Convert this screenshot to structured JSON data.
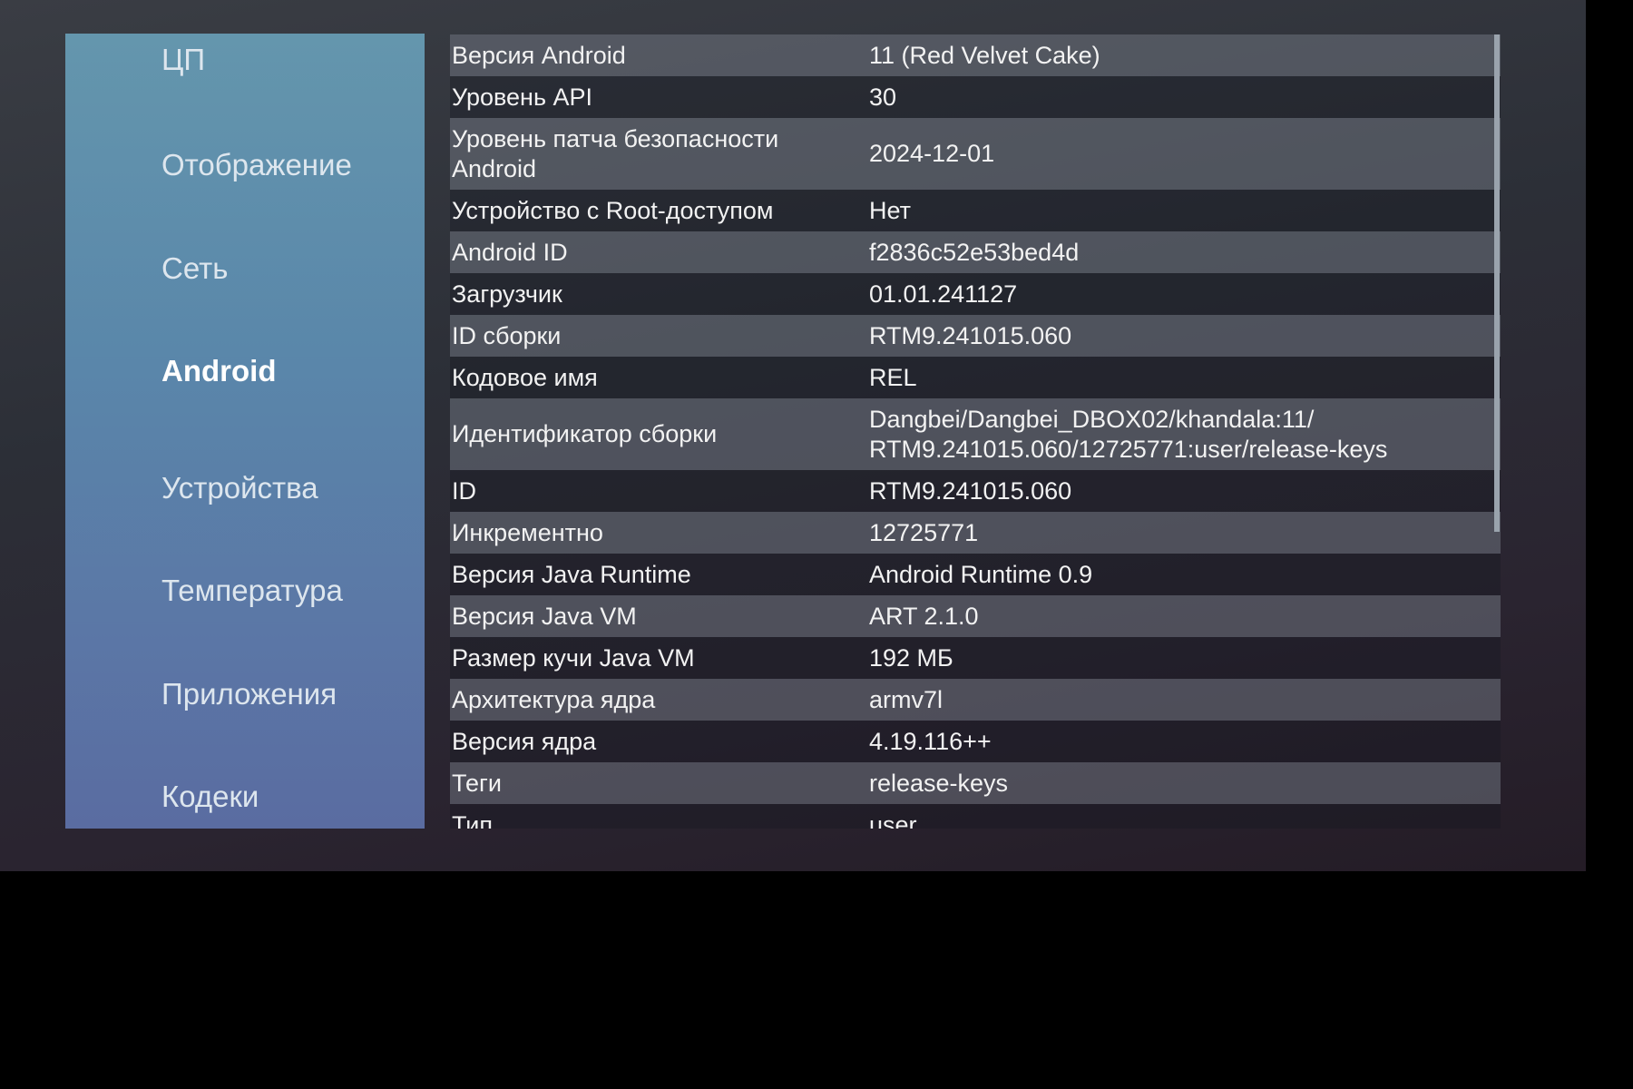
{
  "sidebar": {
    "items": [
      {
        "label": "ЦП"
      },
      {
        "label": "Отображение"
      },
      {
        "label": "Сеть"
      },
      {
        "label": "Android",
        "active": true
      },
      {
        "label": "Устройства"
      },
      {
        "label": "Температура"
      },
      {
        "label": "Приложения"
      },
      {
        "label": "Кодеки"
      }
    ]
  },
  "table": {
    "rows": [
      {
        "key": "Версия Android",
        "value": "11 (Red Velvet Cake)"
      },
      {
        "key": "Уровень API",
        "value": "30"
      },
      {
        "key": "Уровень патча безопасности Android",
        "value": "2024-12-01"
      },
      {
        "key": "Устройство с Root-доступом",
        "value": "Нет"
      },
      {
        "key": "Android ID",
        "value": "f2836c52e53bed4d"
      },
      {
        "key": "Загрузчик",
        "value": "01.01.241127"
      },
      {
        "key": "ID сборки",
        "value": "RTM9.241015.060"
      },
      {
        "key": "Кодовое имя",
        "value": "REL"
      },
      {
        "key": "Идентификатор сборки",
        "value": "Dangbei/Dangbei_DBOX02/khandala:11/ RTM9.241015.060/12725771:user/release-keys"
      },
      {
        "key": "ID",
        "value": "RTM9.241015.060"
      },
      {
        "key": "Инкрементно",
        "value": "12725771"
      },
      {
        "key": "Версия Java Runtime",
        "value": "Android Runtime 0.9"
      },
      {
        "key": "Версия Java VM",
        "value": "ART 2.1.0"
      },
      {
        "key": "Размер кучи Java VM",
        "value": "192 МБ"
      },
      {
        "key": "Архитектура ядра",
        "value": "armv7l"
      },
      {
        "key": "Версия ядра",
        "value": "4.19.116++"
      },
      {
        "key": "Теги",
        "value": "release-keys"
      },
      {
        "key": "Тип",
        "value": "user"
      }
    ]
  }
}
